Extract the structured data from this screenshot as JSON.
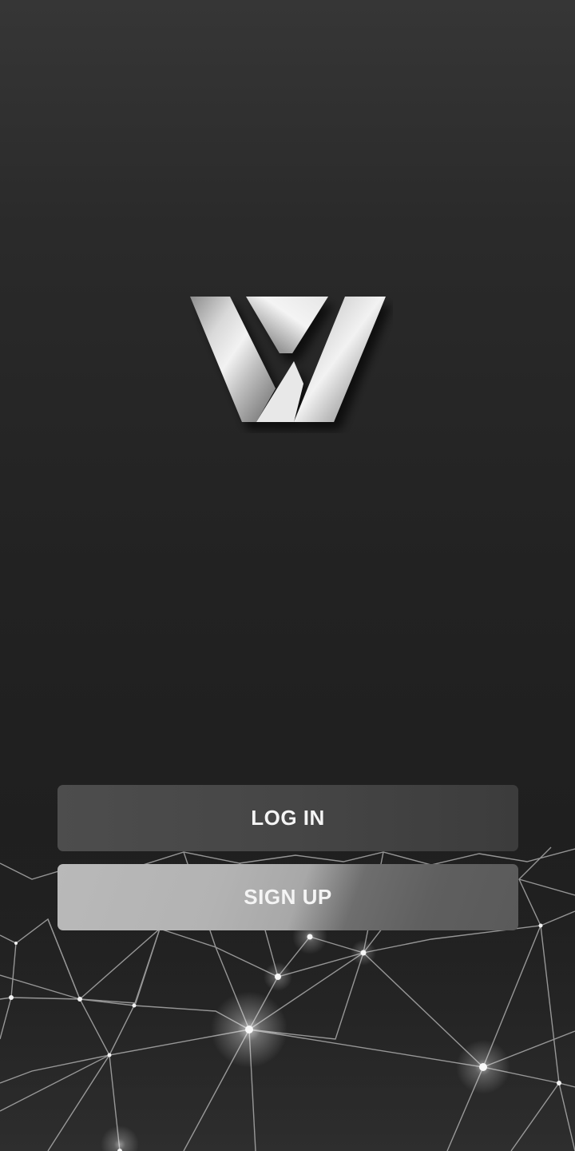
{
  "app": {
    "logo": {
      "letter": "W",
      "icon": "w-logo"
    }
  },
  "actions": {
    "login_label": "LOG IN",
    "signup_label": "SIGN UP"
  },
  "colors": {
    "background": "#222222",
    "login_button": "#464646",
    "signup_button_start": "#b9b9b9",
    "signup_button_end": "#5a5a5a",
    "button_text": "#f4f4f4"
  }
}
